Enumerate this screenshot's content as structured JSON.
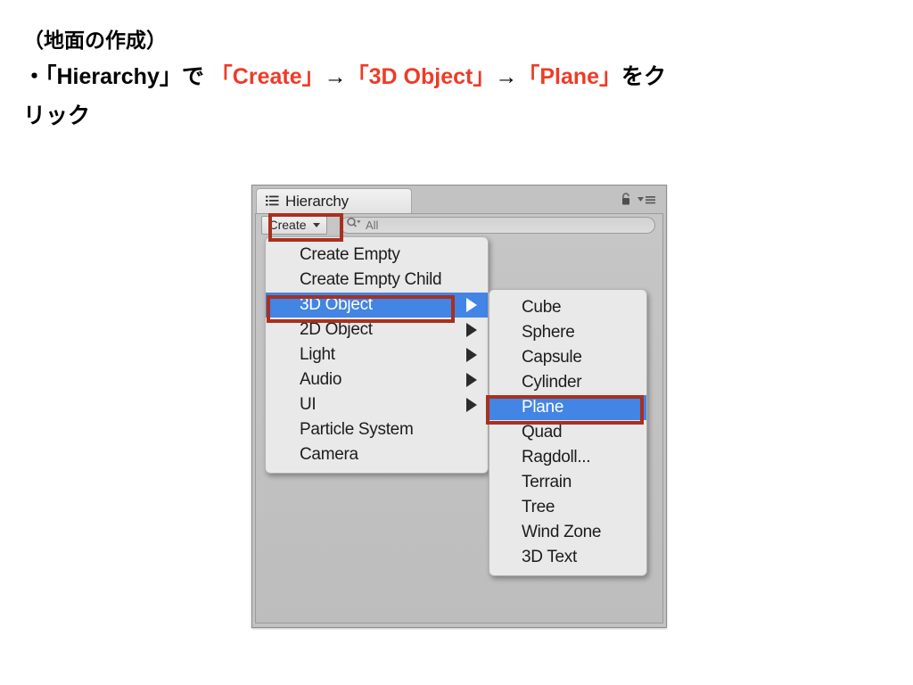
{
  "caption": {
    "line1": "（地面の作成）",
    "line2_prefix": "・「Hierarchy」で ",
    "line2_create": "「Create」",
    "line2_arrow1": "→",
    "line2_3dobject": "「3D Object」",
    "line2_arrow2": "→",
    "line2_plane": "「Plane」",
    "line2_suffix": "をク",
    "line3": "リック",
    "highlight_color": "#ee3b27",
    "text_color": "#000000"
  },
  "panel": {
    "tab_label": "Hierarchy",
    "tab_icon": "hierarchy-list-icon",
    "lock_icon": "lock-icon",
    "menu_icon": "panel-options-icon",
    "toolbar": {
      "create_label": "Create",
      "create_caret": "chevron-down-icon",
      "search_icon": "search-icon",
      "search_value": "All",
      "search_placeholder": "All"
    },
    "background_color": "#c2c2c2"
  },
  "menu_main": {
    "items": [
      {
        "label": "Create Empty",
        "submenu": false,
        "selected": false
      },
      {
        "label": "Create Empty Child",
        "submenu": false,
        "selected": false
      },
      {
        "label": "3D Object",
        "submenu": true,
        "selected": true
      },
      {
        "label": "2D Object",
        "submenu": true,
        "selected": false
      },
      {
        "label": "Light",
        "submenu": true,
        "selected": false
      },
      {
        "label": "Audio",
        "submenu": true,
        "selected": false
      },
      {
        "label": "UI",
        "submenu": true,
        "selected": false
      },
      {
        "label": "Particle System",
        "submenu": false,
        "selected": false
      },
      {
        "label": "Camera",
        "submenu": false,
        "selected": false
      }
    ]
  },
  "menu_sub": {
    "items": [
      {
        "label": "Cube",
        "selected": false
      },
      {
        "label": "Sphere",
        "selected": false
      },
      {
        "label": "Capsule",
        "selected": false
      },
      {
        "label": "Cylinder",
        "selected": false
      },
      {
        "label": "Plane",
        "selected": true
      },
      {
        "label": "Quad",
        "selected": false
      },
      {
        "label": "Ragdoll...",
        "selected": false
      },
      {
        "label": "Terrain",
        "selected": false
      },
      {
        "label": "Tree",
        "selected": false
      },
      {
        "label": "Wind Zone",
        "selected": false
      },
      {
        "label": "3D Text",
        "selected": false
      }
    ]
  },
  "annotations": {
    "color": "#a8301f",
    "targets": [
      "Create",
      "3D Object",
      "Plane"
    ]
  },
  "colors": {
    "selection_blue": "#4285e4",
    "annotation_red": "#a8301f",
    "caption_red": "#ee3b27"
  }
}
